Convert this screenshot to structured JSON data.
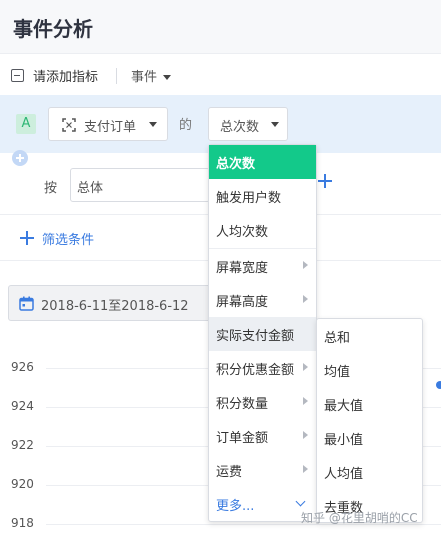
{
  "page": {
    "title": "事件分析"
  },
  "metric_header": {
    "add_metric_label": "请添加指标",
    "event_dropdown_label": "事件"
  },
  "metric_row": {
    "badge": "A",
    "event_select_label": "支付订单",
    "connector": "的",
    "aggregation_label": "总次数"
  },
  "group_by": {
    "label": "按",
    "value": "总体"
  },
  "filter": {
    "label": "筛选条件"
  },
  "date_range": {
    "label": "2018-6-11至2018-6-12"
  },
  "y_axis_ticks": [
    "926",
    "924",
    "922",
    "920",
    "918"
  ],
  "dropdown_menu": {
    "items": [
      {
        "label": "总次数",
        "has_submenu": false
      },
      {
        "label": "触发用户数",
        "has_submenu": false
      },
      {
        "label": "人均次数",
        "has_submenu": false
      },
      {
        "label": "屏幕宽度",
        "has_submenu": true
      },
      {
        "label": "屏幕高度",
        "has_submenu": true
      },
      {
        "label": "实际支付金额",
        "has_submenu": true
      },
      {
        "label": "积分优惠金额",
        "has_submenu": true
      },
      {
        "label": "积分数量",
        "has_submenu": true
      },
      {
        "label": "订单金额",
        "has_submenu": true
      },
      {
        "label": "运费",
        "has_submenu": true
      }
    ],
    "more_label": "更多..."
  },
  "submenu": {
    "items": [
      {
        "label": "总和"
      },
      {
        "label": "均值"
      },
      {
        "label": "最大值"
      },
      {
        "label": "最小值"
      },
      {
        "label": "人均值"
      },
      {
        "label": "去重数"
      }
    ]
  },
  "watermark": "知乎 @花里胡哨的CC",
  "colors": {
    "accent_blue": "#3a7be0",
    "selected_green": "#13c98a",
    "band_blue": "#e6f0fb"
  }
}
